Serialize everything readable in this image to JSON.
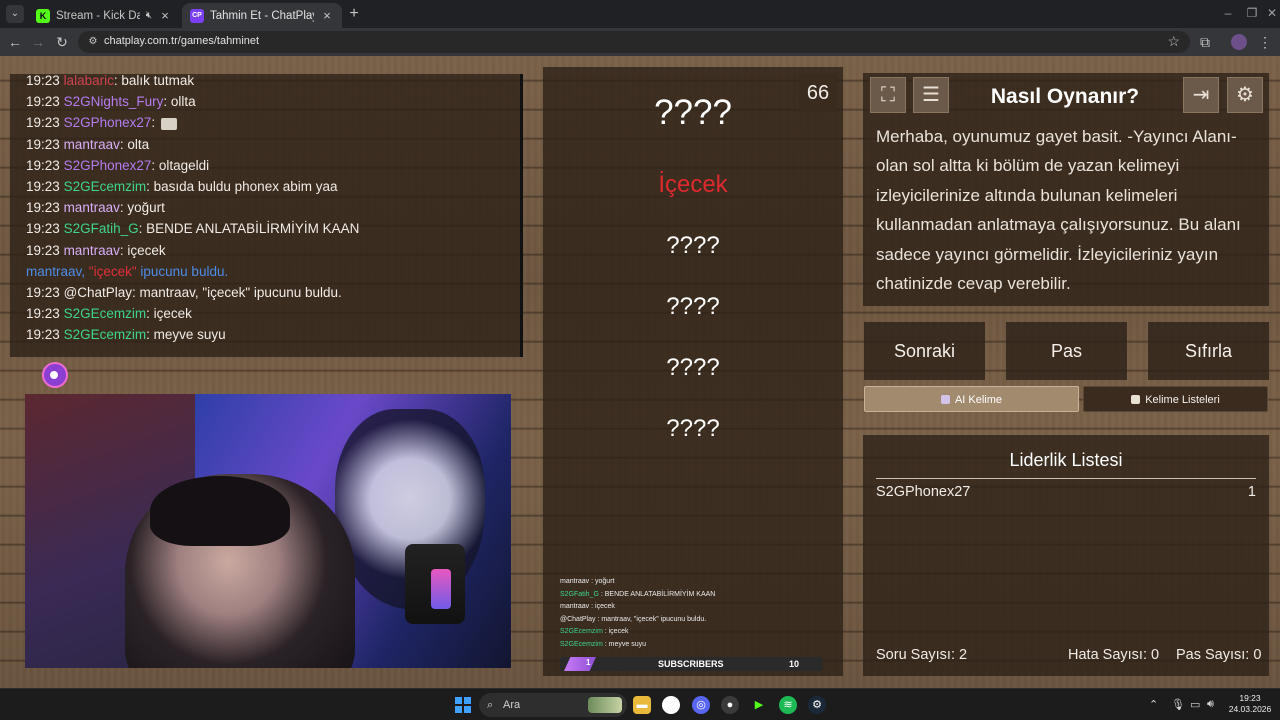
{
  "browser": {
    "tabs": [
      {
        "title": "Stream - Kick Dashboard",
        "favicon": "K",
        "active": false,
        "muted": true
      },
      {
        "title": "Tahmin Et - ChatPlay",
        "favicon": "CP",
        "active": true
      }
    ],
    "url": "chatplay.com.tr/games/tahminet",
    "accent": "#53fc18"
  },
  "chat": {
    "lines": [
      {
        "time": "19:23",
        "user": "lalabaric",
        "userColor": "red",
        "msg": ": balık tutmak"
      },
      {
        "time": "19:23",
        "user": "S2GNights_Fury",
        "userColor": "purple",
        "msg": ": ollta"
      },
      {
        "time": "19:23",
        "user": "S2GPhonex27",
        "userColor": "purple",
        "msg": ": ",
        "emote": true
      },
      {
        "time": "19:23",
        "user": "mantraav",
        "userColor": "lav",
        "msg": ": olta"
      },
      {
        "time": "19:23",
        "user": "S2GPhonex27",
        "userColor": "purple",
        "msg": ": oltageldi"
      },
      {
        "time": "19:23",
        "user": "S2GEcemzim",
        "userColor": "green",
        "msg": ": basıda buldu phonex abim yaa"
      },
      {
        "time": "19:23",
        "user": "mantraav",
        "userColor": "lav",
        "msg": ": yoğurt"
      },
      {
        "time": "19:23",
        "user": "S2GFatih_G",
        "userColor": "green",
        "msg": ": BENDE ANLATABİLİRMİYİM KAAN"
      },
      {
        "time": "19:23",
        "user": "mantraav",
        "userColor": "lav",
        "msg": ": içecek"
      }
    ],
    "notice": {
      "pre": "mantraav, ",
      "hl": "\"içecek\"",
      "post": " ipucunu buldu."
    },
    "tail": [
      {
        "time": "19:23",
        "user": "@ChatPlay",
        "userColor": "white",
        "msg": ": mantraav, \"içecek\" ipucunu buldu."
      },
      {
        "time": "19:23",
        "user": "S2GEcemzim",
        "userColor": "green",
        "msg": ": içecek"
      },
      {
        "time": "19:23",
        "user": "S2GEcemzim",
        "userColor": "green",
        "msg": ": meyve suyu"
      }
    ]
  },
  "game": {
    "counter": "66",
    "target": "????",
    "found_hint": "İçecek",
    "hints": [
      "????",
      "????",
      "????",
      "????"
    ]
  },
  "overlay": {
    "mini_chat": [
      {
        "user": "mantraav",
        "msg": " : yoğurt"
      },
      {
        "user": "S2GFatih_G",
        "msg": " : BENDE ANLATABİLİRMİYİM KAAN",
        "green": true
      },
      {
        "user": "mantraav",
        "msg": " : içecek"
      },
      {
        "user": "@ChatPlay",
        "msg": " : mantraav, \"içecek\" ipucunu buldu."
      },
      {
        "user": "S2GEcemzim",
        "msg": " : içecek",
        "green": true
      },
      {
        "user": "S2GEcemzim",
        "msg": " : meyve suyu",
        "green": true
      }
    ],
    "bar_label": "SUBSCRIBERS",
    "bar_count": "10",
    "bar_badge": "1"
  },
  "help": {
    "title": "Nasıl Oynanır?",
    "text": "Merhaba, oyunumuz gayet basit. -Yayıncı Alanı-olan sol altta ki bölüm de yazan kelimeyi izleyicilerinize altında bulunan kelimeleri kullanmadan anlatmaya çalışıyorsunuz. Bu alanı sadece yayıncı görmelidir. İzleyicileriniz yayın chatinizde cevap verebilir."
  },
  "controls": {
    "next": "Sonraki",
    "pass": "Pas",
    "reset": "Sıfırla",
    "ai_word": "AI Kelime",
    "word_lists": "Kelime Listeleri"
  },
  "leaderboard": {
    "title": "Liderlik Listesi",
    "rows": [
      {
        "name": "S2GPhonex27",
        "score": "1"
      }
    ],
    "stats": {
      "questions_label": "Soru Sayısı:",
      "questions": "2",
      "errors_label": "Hata Sayısı:",
      "errors": "0",
      "passes_label": "Pas Sayısı:",
      "passes": "0"
    }
  },
  "taskbar": {
    "search": "Ara",
    "time": "19:23",
    "date": "24.03.2026"
  }
}
